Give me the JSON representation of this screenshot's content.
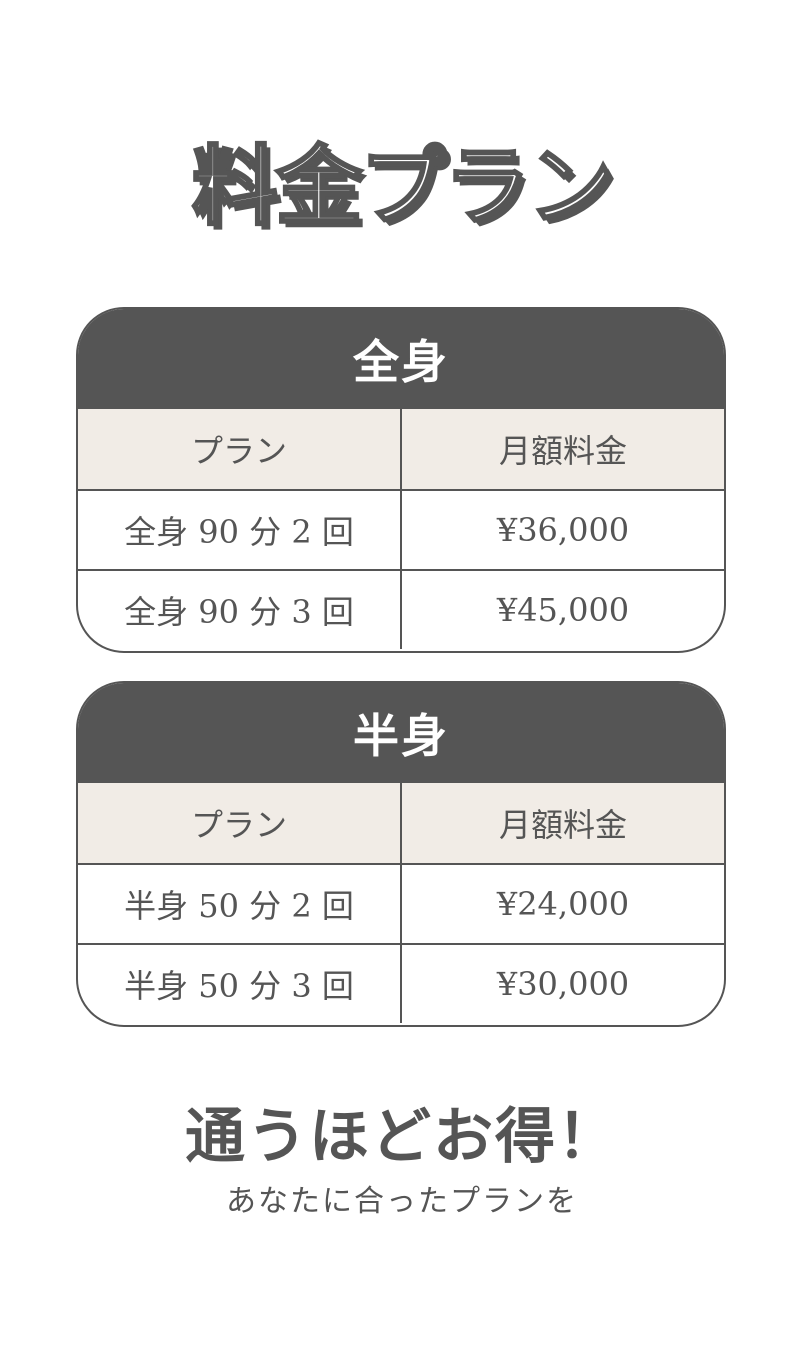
{
  "title": "料金プラン",
  "plans": [
    {
      "heading": "全身",
      "columns": [
        "プラン",
        "月額料金"
      ],
      "rows": [
        {
          "plan": "全身 90 分 2 回",
          "price": "¥36,000"
        },
        {
          "plan": "全身 90 分 3 回",
          "price": "¥45,000"
        }
      ]
    },
    {
      "heading": "半身",
      "columns": [
        "プラン",
        "月額料金"
      ],
      "rows": [
        {
          "plan": "半身 50 分 2 回",
          "price": "¥24,000"
        },
        {
          "plan": "半身 50 分 3 回",
          "price": "¥30,000"
        }
      ]
    }
  ],
  "tagline": {
    "main": "通うほどお得！",
    "sub": "あなたに合ったプランを"
  },
  "colors": {
    "primary": "#555555",
    "header_row_bg": "#f1ece6",
    "background": "#ffffff"
  }
}
